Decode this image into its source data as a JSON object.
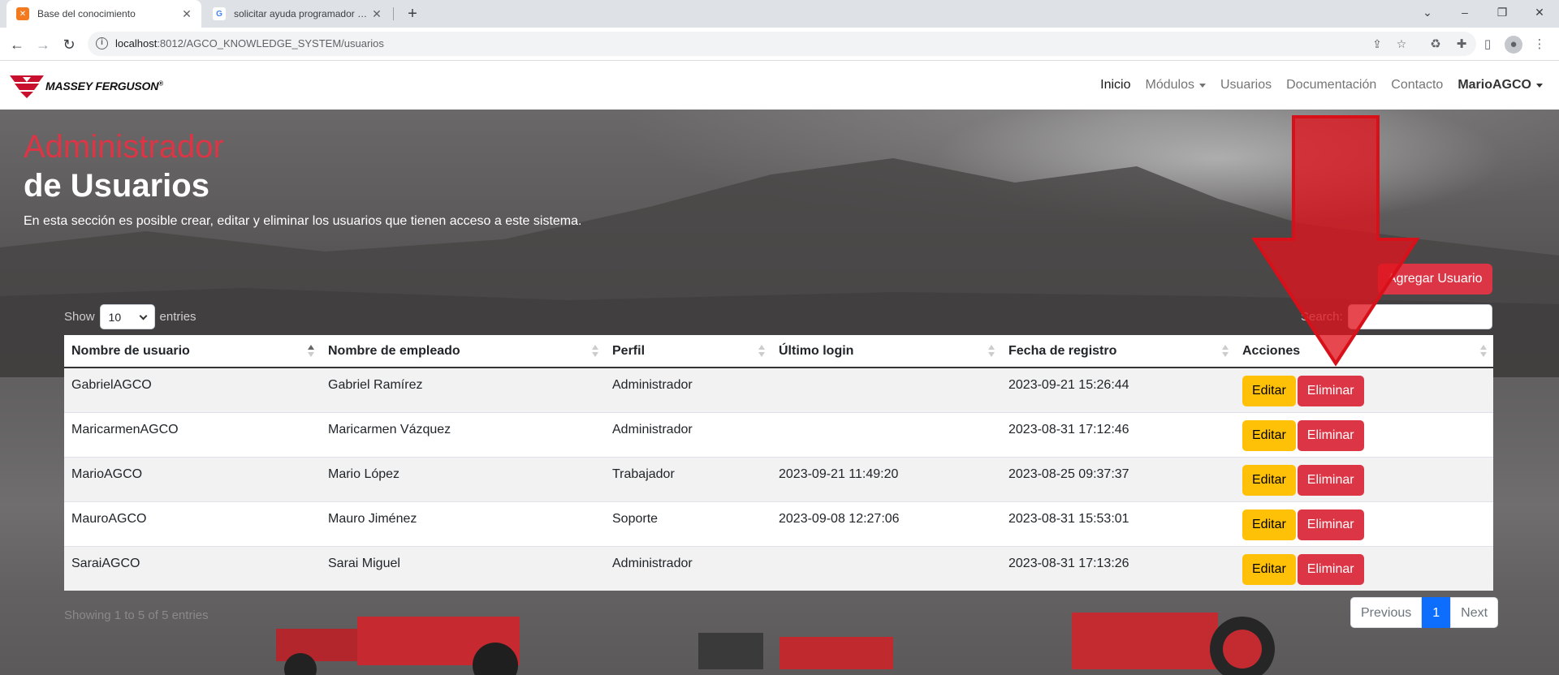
{
  "browser": {
    "tabs": [
      {
        "title": "Base del conocimiento",
        "favicon": "xampp-icon",
        "active": true
      },
      {
        "title": "solicitar ayuda programador - Bu",
        "favicon": "google-icon",
        "active": false
      }
    ],
    "url_host": "localhost",
    "url_path": ":8012/AGCO_KNOWLEDGE_SYSTEM/usuarios"
  },
  "navbar": {
    "brand": "MASSEY FERGUSON",
    "brand_mark": "®",
    "items": [
      {
        "label": "Inicio",
        "active": true
      },
      {
        "label": "Módulos",
        "dropdown": true
      },
      {
        "label": "Usuarios"
      },
      {
        "label": "Documentación"
      },
      {
        "label": "Contacto"
      },
      {
        "label": "MarioAGCO",
        "dropdown": true
      }
    ]
  },
  "hero": {
    "title_line1": "Administrador",
    "title_line2": "de Usuarios",
    "description": "En esta sección es posible crear, editar y eliminar los usuarios que tienen acceso a este sistema."
  },
  "actions": {
    "add_user": "Agregar Usuario"
  },
  "table_controls": {
    "show_label": "Show",
    "page_size": "10",
    "entries_label": "entries",
    "search_label": "Search:",
    "info": "Showing 1 to 5 of 5 entries",
    "previous": "Previous",
    "current_page": "1",
    "next": "Next"
  },
  "table": {
    "columns": [
      "Nombre de usuario",
      "Nombre de empleado",
      "Perfil",
      "Último login",
      "Fecha de registro",
      "Acciones"
    ],
    "edit_label": "Editar",
    "delete_label": "Eliminar",
    "rows": [
      {
        "usuario": "GabrielAGCO",
        "empleado": "Gabriel Ramírez",
        "perfil": "Administrador",
        "login": "",
        "registro": "2023-09-21 15:26:44"
      },
      {
        "usuario": "MaricarmenAGCO",
        "empleado": "Maricarmen Vázquez",
        "perfil": "Administrador",
        "login": "",
        "registro": "2023-08-31 17:12:46"
      },
      {
        "usuario": "MarioAGCO",
        "empleado": "Mario López",
        "perfil": "Trabajador",
        "login": "2023-09-21 11:49:20",
        "registro": "2023-08-25 09:37:37"
      },
      {
        "usuario": "MauroAGCO",
        "empleado": "Mauro Jiménez",
        "perfil": "Soporte",
        "login": "2023-09-08 12:27:06",
        "registro": "2023-08-31 15:53:01"
      },
      {
        "usuario": "SaraiAGCO",
        "empleado": "Sarai Miguel",
        "perfil": "Administrador",
        "login": "",
        "registro": "2023-08-31 17:13:26"
      }
    ]
  },
  "colors": {
    "brand_red": "#dc3545",
    "warning_yellow": "#ffc107",
    "primary_blue": "#0d6efd",
    "annotation_arrow": "#e0141e"
  }
}
